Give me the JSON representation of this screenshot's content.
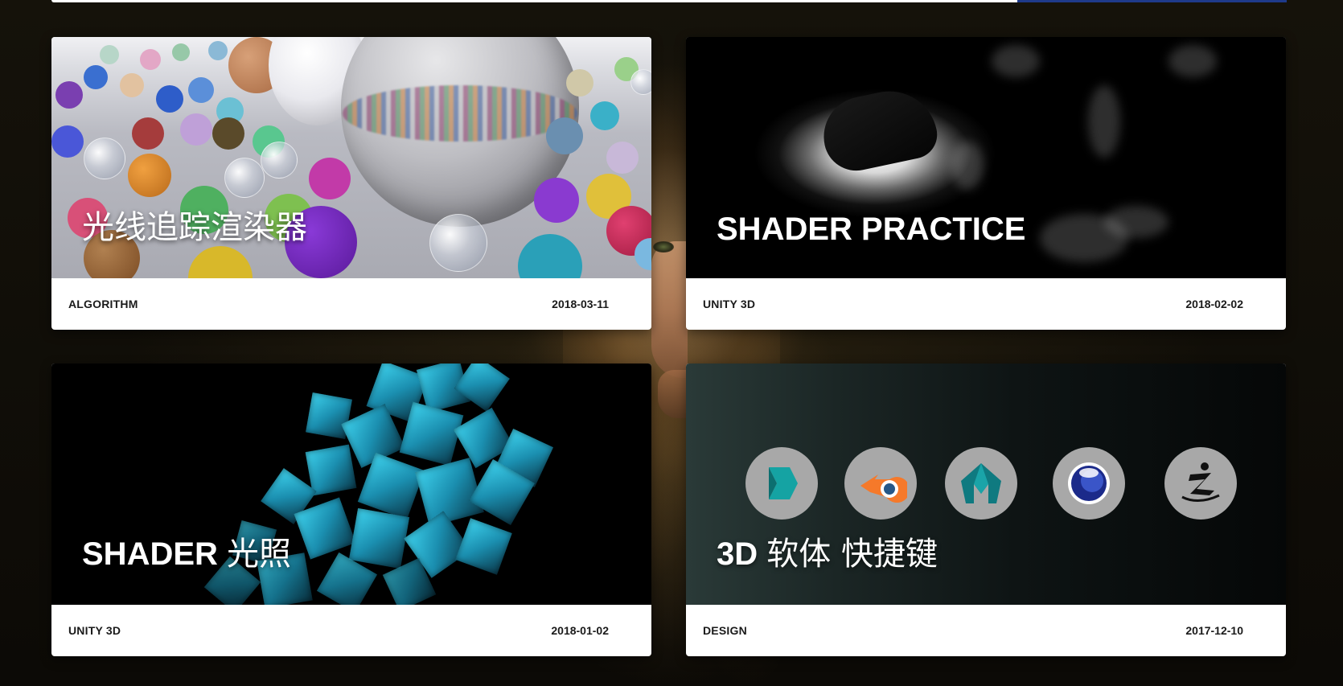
{
  "posts": [
    {
      "title": "光线追踪渲染器",
      "category": "ALGORITHM",
      "date": "2018-03-11"
    },
    {
      "title": "SHADER PRACTICE",
      "category": "UNITY 3D",
      "date": "2018-02-02"
    },
    {
      "title_latin": "SHADER",
      "title_cjk": "光照",
      "category": "UNITY 3D",
      "date": "2018-01-02"
    },
    {
      "title_latin": "3D",
      "title_cjk": "软体 快捷键",
      "category": "DESIGN",
      "date": "2017-12-10",
      "software_icons": [
        "3ds-max-icon",
        "blender-icon",
        "maya-icon",
        "cinema4d-icon",
        "zbrush-icon"
      ]
    }
  ],
  "colors": {
    "card_bg": "#ffffff",
    "text_dark": "#1a1a1a",
    "title_text": "#ffffff",
    "cube_cyan": "#3fd3ee",
    "blender_orange": "#f5792a",
    "blender_blue": "#265787",
    "maya_teal": "#0f7a80",
    "max_teal": "#15a3a3",
    "c4d_blue": "#1b2a8a"
  }
}
